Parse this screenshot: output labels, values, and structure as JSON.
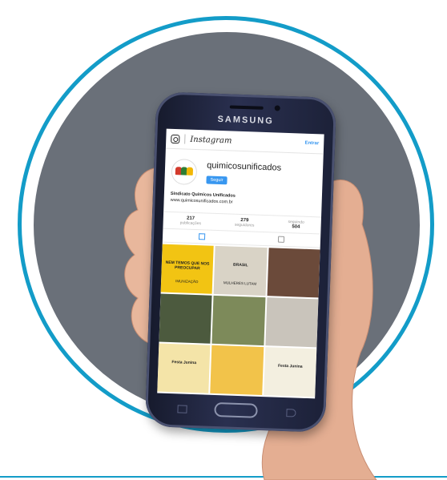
{
  "phone": {
    "brand": "SAMSUNG"
  },
  "instagram": {
    "wordmark": "Instagram",
    "login_label": "Entrar",
    "username": "quimicosunificados",
    "follow_label": "Seguir",
    "bio_name": "Sindicato Químicos Unificados",
    "bio_link": "www.quimicosunificados.com.br",
    "stats": [
      {
        "value": "217",
        "label": "publicações"
      },
      {
        "value": "279",
        "label": "seguidores"
      },
      {
        "value": "504",
        "label": "seguindo"
      }
    ],
    "posts": [
      {
        "caption": "NEM TEMOS QUE NOS PREOCUPAR",
        "sub": "IMUNIZAÇÃO",
        "bg": "#f2c413"
      },
      {
        "caption": "BRASIL",
        "sub": "MULHERES LUTAM",
        "bg": "#d9d3c6"
      },
      {
        "caption": "",
        "sub": "",
        "bg": "#6b4a3a"
      },
      {
        "caption": "",
        "sub": "",
        "bg": "#4c5a3e"
      },
      {
        "caption": "",
        "sub": "",
        "bg": "#7d8a5a"
      },
      {
        "caption": "",
        "sub": "",
        "bg": "#c9c4bb"
      },
      {
        "caption": "Festa Junina",
        "sub": "",
        "bg": "#f4e4a8"
      },
      {
        "caption": "",
        "sub": "",
        "bg": "#f2c34a"
      },
      {
        "caption": "Festa Junina",
        "sub": "",
        "bg": "#f3efe0"
      }
    ]
  },
  "colors": {
    "ring": "#139cc8",
    "disc": "#6a7079",
    "ig_blue": "#3897f0"
  }
}
